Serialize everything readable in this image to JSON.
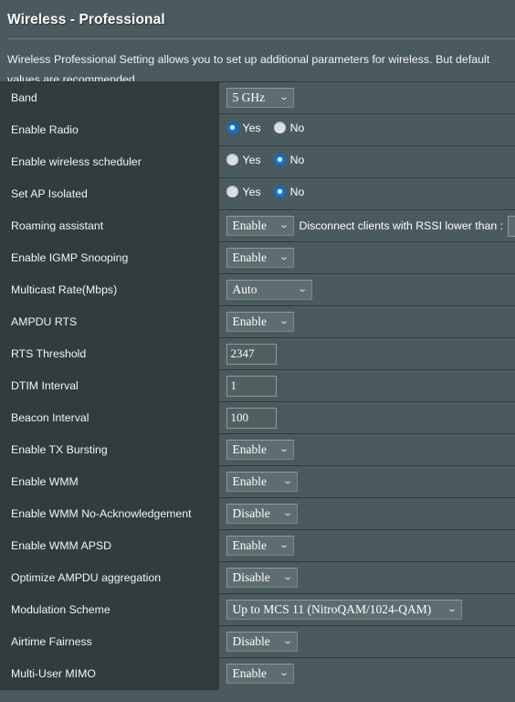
{
  "header": {
    "title": "Wireless - Professional",
    "description": "Wireless Professional Setting allows you to set up additional parameters for wireless. But default values are recommended."
  },
  "icons": {
    "chevron_down": "⌄"
  },
  "colors": {
    "page_background": "#4b5a5e",
    "label_background": "#323b3e",
    "row_border": "#2f383b",
    "radio_checked": "#1177e0",
    "radio_unchecked": "#d9dede",
    "control_background": "#5e6d70",
    "control_border": "#8e9b9d",
    "text": "#ffffff"
  },
  "rows": [
    {
      "label": "Band",
      "control": "select",
      "value": "5 GHz",
      "width": "w-sm",
      "name": "band"
    },
    {
      "label": "Enable Radio",
      "control": "radio",
      "options": [
        "Yes",
        "No"
      ],
      "selected": "Yes",
      "name": "enable-radio"
    },
    {
      "label": "Enable wireless scheduler",
      "control": "radio",
      "options": [
        "Yes",
        "No"
      ],
      "selected": "No",
      "name": "enable-wireless-scheduler"
    },
    {
      "label": "Set AP Isolated",
      "control": "radio",
      "options": [
        "Yes",
        "No"
      ],
      "selected": "No",
      "name": "set-ap-isolated"
    },
    {
      "label": "Roaming assistant",
      "control": "select-with-note",
      "value": "Enable",
      "width": "w-sm",
      "note": "Disconnect clients with RSSI lower than :",
      "note_input_value": "",
      "name": "roaming-assistant"
    },
    {
      "label": "Enable IGMP Snooping",
      "control": "select",
      "value": "Enable",
      "width": "w-sm",
      "name": "enable-igmp-snooping"
    },
    {
      "label": "Multicast Rate(Mbps)",
      "control": "select",
      "value": "Auto",
      "width": "w-lg",
      "name": "multicast-rate"
    },
    {
      "label": "AMPDU RTS",
      "control": "select",
      "value": "Enable",
      "width": "w-sm",
      "name": "ampdu-rts"
    },
    {
      "label": "RTS Threshold",
      "control": "input",
      "value": "2347",
      "name": "rts-threshold"
    },
    {
      "label": "DTIM Interval",
      "control": "input",
      "value": "1",
      "name": "dtim-interval"
    },
    {
      "label": "Beacon Interval",
      "control": "input",
      "value": "100",
      "name": "beacon-interval"
    },
    {
      "label": "Enable TX Bursting",
      "control": "select",
      "value": "Enable",
      "width": "w-sm",
      "name": "enable-tx-bursting"
    },
    {
      "label": "Enable WMM",
      "control": "select",
      "value": "Enable",
      "width": "w-md",
      "name": "enable-wmm"
    },
    {
      "label": "Enable WMM No-Acknowledgement",
      "control": "select",
      "value": "Disable",
      "width": "w-md",
      "name": "enable-wmm-no-acknowledgement"
    },
    {
      "label": "Enable WMM APSD",
      "control": "select",
      "value": "Enable",
      "width": "w-sm",
      "name": "enable-wmm-apsd"
    },
    {
      "label": "Optimize AMPDU aggregation",
      "control": "select",
      "value": "Disable",
      "width": "w-md",
      "name": "optimize-ampdu-aggregation"
    },
    {
      "label": "Modulation Scheme",
      "control": "select",
      "value": "Up to MCS 11 (NitroQAM/1024-QAM)",
      "width": "w-xl",
      "name": "modulation-scheme"
    },
    {
      "label": "Airtime Fairness",
      "control": "select",
      "value": "Disable",
      "width": "w-md",
      "name": "airtime-fairness"
    },
    {
      "label": "Multi-User MIMO",
      "control": "select",
      "value": "Enable",
      "width": "w-sm",
      "name": "multi-user-mimo"
    }
  ]
}
